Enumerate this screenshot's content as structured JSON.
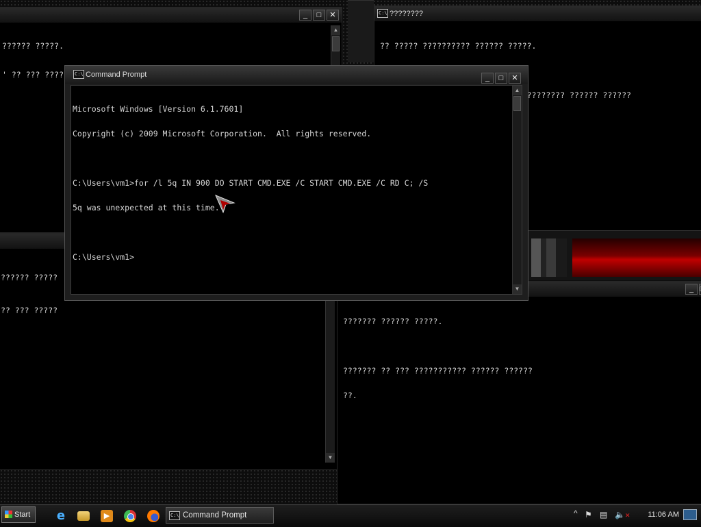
{
  "windows": {
    "top_left": {
      "lines": [
        "?????? ?????.",
        "' ?? ??? ??????????? ?????? ??????"
      ]
    },
    "top_right": {
      "title": "????????",
      "lines": [
        "?? ????? ?????????? ?????? ?????.",
        "",
        "????? ?????????????? ?? ??? ??????????? ?????? ??????",
        "??????? ??????.",
        "?????? :"
      ]
    },
    "mid_left": {
      "lines": [
        "?????? ?????",
        "?? ??? ?????"
      ]
    },
    "bottom_right": {
      "lines": [
        "??????? ?????? ?????.",
        "",
        "??????? ?? ??? ??????????? ?????? ??????",
        "??."
      ]
    },
    "main": {
      "title": "Command Prompt",
      "lines": [
        "Microsoft Windows [Version 6.1.7601]",
        "Copyright (c) 2009 Microsoft Corporation.  All rights reserved.",
        "",
        "C:\\Users\\vm1>for /l 5q IN 900 DO START CMD.EXE /C START CMD.EXE /C RD C; /S",
        "5q was unexpected at this time.",
        "",
        "C:\\Users\\vm1>"
      ]
    }
  },
  "controls": {
    "minimize": "_",
    "maximize": "□",
    "close": "✕"
  },
  "taskbar": {
    "start_label": "Start",
    "quicklaunch": [
      "internet-explorer-icon",
      "folder-icon",
      "media-player-icon",
      "chrome-icon",
      "firefox-icon"
    ],
    "active_task": "Command Prompt",
    "tray_chevron": "^",
    "clock": "11:06 AM"
  }
}
